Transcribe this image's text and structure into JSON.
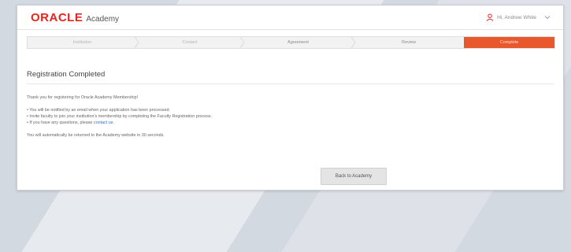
{
  "header": {
    "brand": "ORACLE",
    "brand_suffix": "Academy",
    "user_greeting": "Hi, Andrew White",
    "user_icon": "user-icon",
    "dropdown_icon": "chevron-down-icon"
  },
  "steps": [
    {
      "label": "Institution"
    },
    {
      "label": "Contact"
    },
    {
      "label": "Agreement"
    },
    {
      "label": "Review"
    },
    {
      "label": "Complete"
    }
  ],
  "page": {
    "title": "Registration Completed",
    "thanks": "Thank you for registering for Oracle Academy Membership!",
    "bullets": [
      "• You will be notified by an email when your application has been processed.",
      "• Invite faculty to join your institution's membership by completing the Faculty Registration process."
    ],
    "questions_prefix": "• If you have any questions, please ",
    "contact_link": "contact us",
    "questions_suffix": ".",
    "return_notice": "You will automatically be returned to the Academy website in 30 seconds.",
    "back_button": "Back to Academy"
  },
  "colors": {
    "brand_red": "#e5261f",
    "step_active": "#e9572d",
    "link": "#2d6ec8"
  }
}
